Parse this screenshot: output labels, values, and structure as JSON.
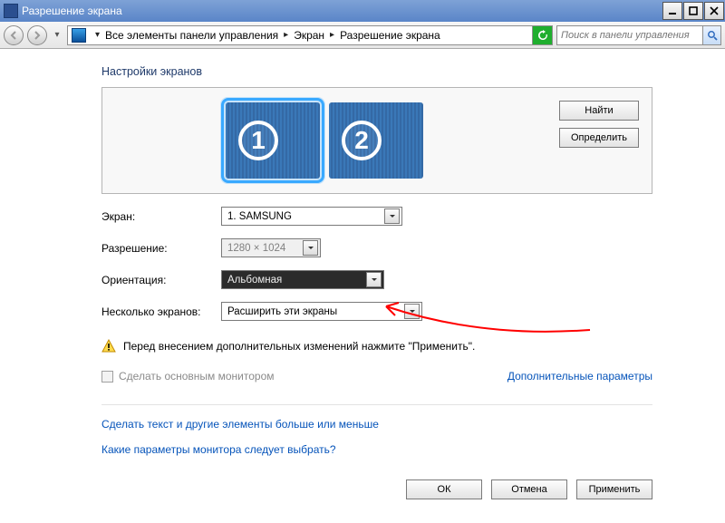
{
  "window": {
    "title": "Разрешение экрана"
  },
  "breadcrumb": {
    "root": "Все элементы панели управления",
    "mid": "Экран",
    "leaf": "Разрешение экрана",
    "search_placeholder": "Поиск в панели управления"
  },
  "heading": "Настройки экранов",
  "monitors": {
    "m1": "1",
    "m2": "2"
  },
  "buttons": {
    "find": "Найти",
    "identify": "Определить"
  },
  "form": {
    "screen_label": "Экран:",
    "screen_value": "1. SAMSUNG",
    "resolution_label": "Разрешение:",
    "resolution_value": "1280 × 1024",
    "orientation_label": "Ориентация:",
    "orientation_value": "Альбомная",
    "multi_label": "Несколько экранов:",
    "multi_value": "Расширить эти экраны"
  },
  "warning": "Перед внесением дополнительных изменений нажмите \"Применить\".",
  "primary_checkbox": "Сделать основным монитором",
  "adv_link": "Дополнительные параметры",
  "link1": "Сделать текст и другие элементы больше или меньше",
  "link2": "Какие параметры монитора следует выбрать?",
  "footer": {
    "ok": "ОК",
    "cancel": "Отмена",
    "apply": "Применить"
  }
}
